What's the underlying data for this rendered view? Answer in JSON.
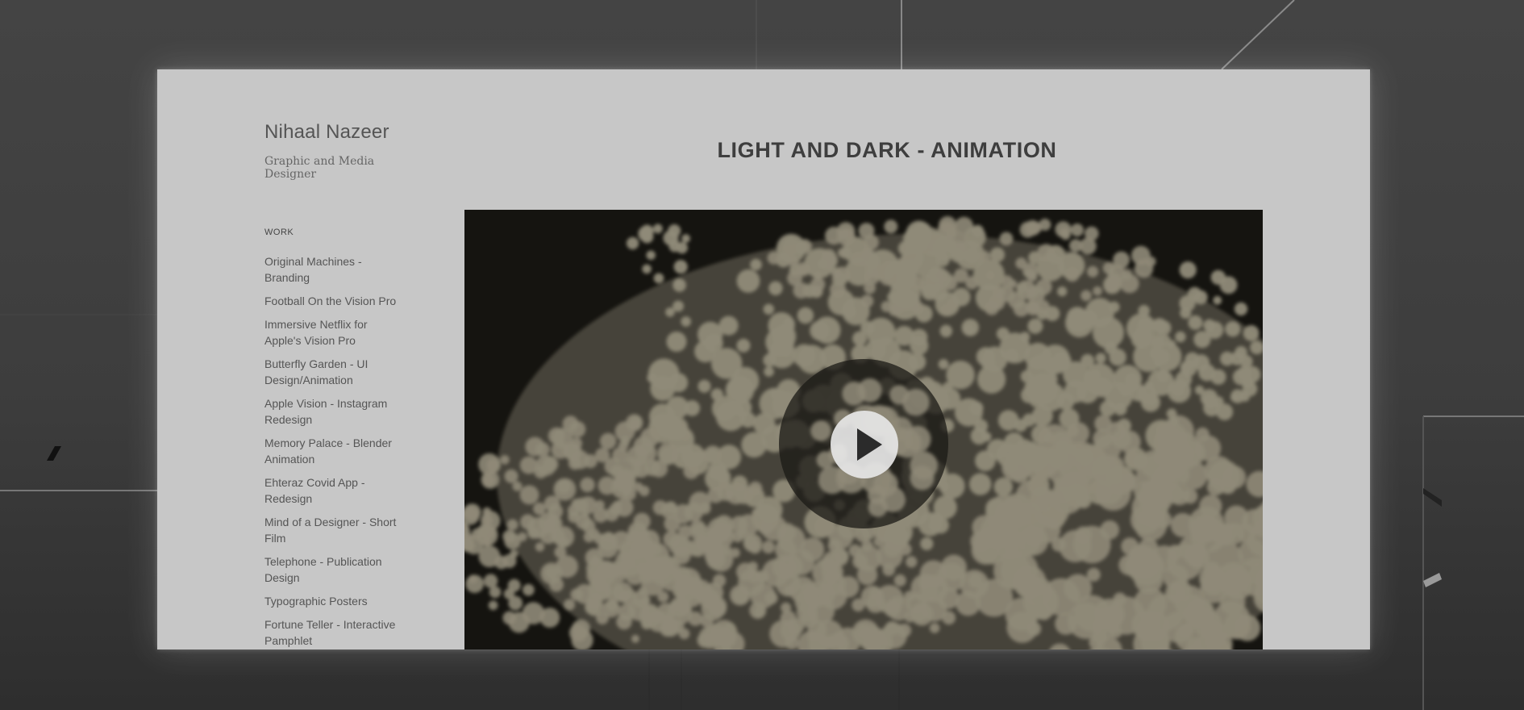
{
  "site": {
    "title": "Nihaal Nazeer",
    "tagline": "Graphic and Media Designer"
  },
  "nav": {
    "heading": "WORK",
    "items": [
      "Original Machines - Branding",
      "Football On the Vision Pro",
      "Immersive Netflix for Apple's Vision Pro",
      "Butterfly Garden - UI Design/Animation",
      "Apple Vision - Instagram Redesign",
      "Memory Palace - Blender Animation",
      "Ehteraz Covid App - Redesign",
      "Mind of a Designer - Short Film",
      "Telephone - Publication Design",
      "Typographic Posters",
      "Fortune Teller - Interactive Pamphlet"
    ]
  },
  "main": {
    "title": "LIGHT AND DARK - ANIMATION"
  },
  "colors": {
    "window_background": "#c7c7c7",
    "outer_background": "#3b3b3b",
    "video_dark": "#151410",
    "particle_tone": "#8f8a78"
  },
  "icons": {
    "play": "play-icon"
  }
}
